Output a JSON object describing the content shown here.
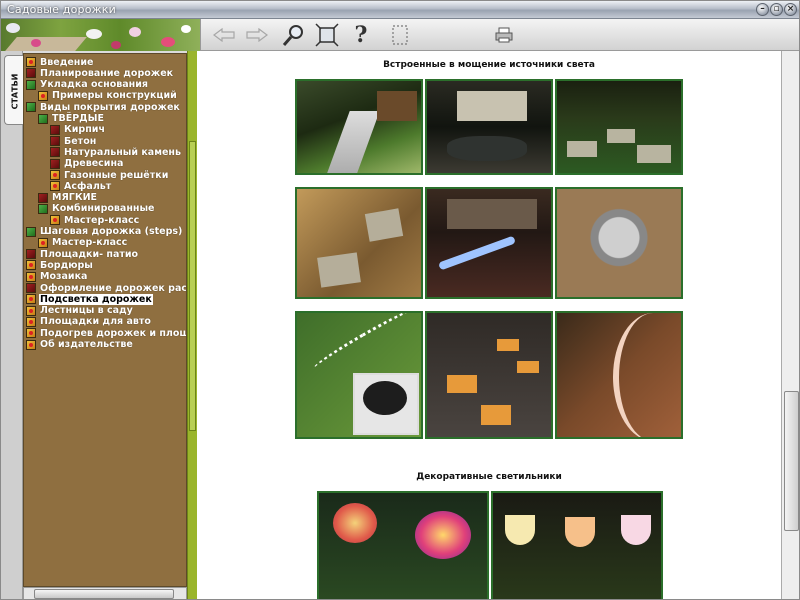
{
  "window": {
    "title": "Садовые дорожки",
    "controls": [
      "minimize-icon",
      "maximize-icon",
      "close-icon"
    ]
  },
  "toolbar": {
    "buttons": [
      "back-arrow-icon",
      "forward-arrow-icon",
      "search-icon",
      "fullscreen-icon",
      "help-icon",
      "selection-icon",
      "print-icon"
    ]
  },
  "side_tab": {
    "label": "СТАТЬИ"
  },
  "tree": {
    "items": [
      {
        "label": "Введение",
        "level": 0,
        "icon": "leaf"
      },
      {
        "label": "Планирование дорожек",
        "level": 0,
        "icon": "red"
      },
      {
        "label": "Укладка основания",
        "level": 0,
        "icon": "folder"
      },
      {
        "label": "Примеры конструкций",
        "level": 1,
        "icon": "leaf"
      },
      {
        "label": "Виды покрытия дорожек",
        "level": 0,
        "icon": "folder"
      },
      {
        "label": "ТВЁРДЫЕ",
        "level": 1,
        "icon": "folder"
      },
      {
        "label": "Кирпич",
        "level": 2,
        "icon": "red"
      },
      {
        "label": "Бетон",
        "level": 2,
        "icon": "red"
      },
      {
        "label": "Натуральный камень",
        "level": 2,
        "icon": "red"
      },
      {
        "label": "Древесина",
        "level": 2,
        "icon": "red"
      },
      {
        "label": "Газонные решётки",
        "level": 2,
        "icon": "leaf"
      },
      {
        "label": "Асфальт",
        "level": 2,
        "icon": "leaf"
      },
      {
        "label": "МЯГКИЕ",
        "level": 1,
        "icon": "red"
      },
      {
        "label": "Комбинированные",
        "level": 1,
        "icon": "folder"
      },
      {
        "label": "Мастер-класс",
        "level": 2,
        "icon": "leaf"
      },
      {
        "label": "Шаговая дорожка (steps)",
        "level": 0,
        "icon": "folder"
      },
      {
        "label": "Мастер-класс",
        "level": 1,
        "icon": "leaf"
      },
      {
        "label": "Площадки- патио",
        "level": 0,
        "icon": "red"
      },
      {
        "label": "Бордюры",
        "level": 0,
        "icon": "leaf"
      },
      {
        "label": "Мозаика",
        "level": 0,
        "icon": "leaf"
      },
      {
        "label": "Оформление дорожек растения",
        "level": 0,
        "icon": "red"
      },
      {
        "label": "Подсветка дорожек",
        "level": 0,
        "icon": "leaf",
        "selected": true
      },
      {
        "label": "Лестницы в саду",
        "level": 0,
        "icon": "leaf"
      },
      {
        "label": "Площадки для авто",
        "level": 0,
        "icon": "leaf"
      },
      {
        "label": "Подогрев дорожек и площадок",
        "level": 0,
        "icon": "leaf"
      },
      {
        "label": "Об издательстве",
        "level": 0,
        "icon": "leaf"
      }
    ]
  },
  "content": {
    "section1_title": "Встроенные в мощение источники света",
    "section2_title": "Декоративные светильники"
  },
  "colors": {
    "tree_bg": "#8f6f40",
    "accent_green": "#9ab52c",
    "photo_border": "#2b6f2b"
  }
}
